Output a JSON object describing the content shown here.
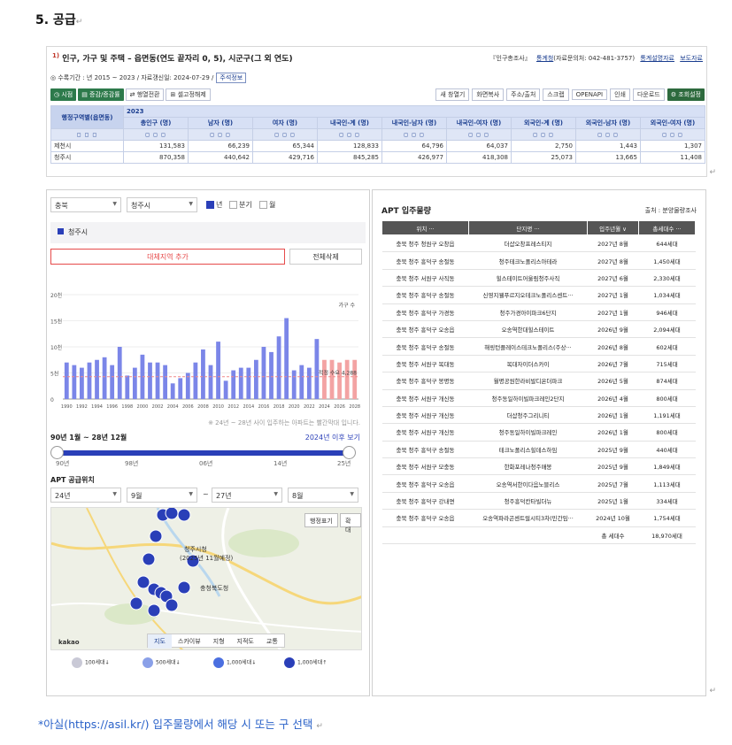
{
  "heading": "5.  공급",
  "kosis": {
    "title_sup": "1)",
    "title": "인구, 가구 및 주택 – 읍면동(연도 끝자리 0, 5), 시군구(그 외 연도)",
    "src_label": "『인구총조사』",
    "src_link": "통계청",
    "src_contact": "(자료문의처: 042-481-3757)",
    "link_desc": "통계설명자료",
    "link_press": "보도자료",
    "period_text": "◎ 수록기간 : 년 2015 ~ 2023 / 자료갱신일: 2024-07-29 /",
    "period_pill": "주석정보",
    "btn_period": "◷ 시점",
    "btn_item": "▤ 증감/증감률",
    "btn_toggle": "⇄ 행열전환",
    "btn_cell": "⊞ 셀고정해제",
    "tools": [
      "새 창열기",
      "화면복사",
      "주소/출처",
      "스크랩",
      "OPENAPI",
      "인쇄",
      "다운로드"
    ],
    "tool_setting": "⚙ 조회설정",
    "row_header": "행정구역별(읍면동)",
    "year": "2023",
    "columns": [
      "총인구 (명)",
      "남자 (명)",
      "여자 (명)",
      "내국인-계 (명)",
      "내국인-남자 (명)",
      "내국인-여자 (명)",
      "외국인-계 (명)",
      "외국인-남자 (명)",
      "외국인-여자 (명)"
    ],
    "ctl": "◻ ◻ ◻",
    "rows": [
      {
        "name": "제천시",
        "values": [
          "131,583",
          "66,239",
          "65,344",
          "128,833",
          "64,796",
          "64,037",
          "2,750",
          "1,443",
          "1,307"
        ]
      },
      {
        "name": "청주시",
        "values": [
          "870,358",
          "440,642",
          "429,716",
          "845,285",
          "426,977",
          "418,308",
          "25,073",
          "13,665",
          "11,408"
        ]
      }
    ]
  },
  "left": {
    "sel_region": "충북",
    "sel_city": "청주시",
    "chk_year": "년",
    "chk_quarter": "분기",
    "chk_month": "월",
    "legend": "청주시",
    "add_btn": "대체지역 추가",
    "del_btn": "전체삭제",
    "chart_note": "※ 24년 ~ 28년 사이 입주하는 아파트는 빨간막대 입니다.",
    "range_label": "90년 1월 ~ 28년 12월",
    "range_link": "2024년 이후 보기",
    "slider_ticks": [
      "90년",
      "98년",
      "06년",
      "14년",
      "25년"
    ],
    "supply_title": "APT 공급위치",
    "sel_from_year": "24년",
    "sel_from_month": "9월",
    "tilde": "~",
    "sel_to_year": "27년",
    "sel_to_month": "8월",
    "map_btn1": "행정표기",
    "map_btn2": "확대",
    "map_labels": [
      "청주시청",
      "(2025년 11월예정)",
      "충청북도청"
    ],
    "map_nav": [
      "지도",
      "스카이뷰",
      "지형",
      "지적도",
      "교통"
    ],
    "map_logo": "kakao",
    "pin_legend": [
      "100세대↓",
      "500세대↓",
      "1,000세대↓",
      "1,000세대↑"
    ]
  },
  "chart_data": {
    "type": "bar",
    "title": "",
    "series_label": "가구 수",
    "x": [
      1990,
      1991,
      1992,
      1993,
      1994,
      1995,
      1996,
      1997,
      1998,
      1999,
      2000,
      2001,
      2002,
      2003,
      2004,
      2005,
      2006,
      2007,
      2008,
      2009,
      2010,
      2011,
      2012,
      2013,
      2014,
      2015,
      2016,
      2017,
      2018,
      2019,
      2020,
      2021,
      2022,
      2023,
      2024,
      2025,
      2026,
      2027,
      2028
    ],
    "xticks": [
      "1990",
      "1992",
      "1994",
      "1996",
      "1998",
      "2000",
      "2002",
      "2004",
      "2006",
      "2008",
      "2010",
      "2012",
      "2014",
      "2016",
      "2018",
      "2020",
      "2022",
      "2024",
      "2026",
      "2028"
    ],
    "values": [
      7000,
      6500,
      6000,
      7000,
      7500,
      8000,
      6500,
      10000,
      4500,
      6000,
      8500,
      7000,
      7000,
      6500,
      3000,
      4000,
      5000,
      7000,
      9500,
      6500,
      11000,
      3500,
      5500,
      6000,
      6000,
      7500,
      10000,
      9000,
      12000,
      15500,
      5500,
      6500,
      6000,
      11500,
      7500,
      7500,
      7000,
      7500,
      7500
    ],
    "forecast_from": 2024,
    "demand_line": 4288,
    "demand_label": "적정 수요 4,288",
    "yticks": [
      0,
      5000,
      10000,
      15000,
      20000
    ],
    "ytick_labels": [
      "0",
      "5천",
      "10천",
      "15천",
      "20천"
    ],
    "ylim": [
      0,
      20000
    ],
    "colors": {
      "actual": "#7b86e8",
      "forecast": "#f3a3a3",
      "line": "#f08a8a"
    }
  },
  "right": {
    "title": "APT 입주물량",
    "source": "출처 : 분양물량조사",
    "headers": [
      "위치 ···",
      "단지명 ···",
      "입주년월 ∨",
      "총세대수 ···"
    ],
    "rows": [
      [
        "충북 청주 청원구 오창읍",
        "더샵오창프레스티지",
        "2027년 8월",
        "644세대"
      ],
      [
        "충북 청주 흥덕구 송절동",
        "청주테크노폴리스아테라",
        "2027년 8월",
        "1,450세대"
      ],
      [
        "충북 청주 서원구 사직동",
        "힐스테이트어울림청주사직",
        "2027년 6월",
        "2,330세대"
      ],
      [
        "충북 청주 흥덕구 송절동",
        "신영지웰푸르지오테크노폴리스센트···",
        "2027년 1월",
        "1,034세대"
      ],
      [
        "충북 청주 흥덕구 가경동",
        "청주가경아이파크6단지",
        "2027년 1월",
        "946세대"
      ],
      [
        "충북 청주 흥덕구 오송읍",
        "오송역한대힐스테이트",
        "2026년 9월",
        "2,094세대"
      ],
      [
        "충북 청주 흥덕구 송절동",
        "해링턴플레이스테크노폴리스(주상···",
        "2026년 8월",
        "602세대"
      ],
      [
        "충북 청주 서원구 복대동",
        "복대자이더스카이",
        "2026년 7월",
        "715세대"
      ],
      [
        "충북 청주 흥덕구 봉명동",
        "월명공원한라비발디온더파크",
        "2026년 5월",
        "874세대"
      ],
      [
        "충북 청주 서원구 개신동",
        "청주동일하이빌파크레인2단지",
        "2026년 4월",
        "800세대"
      ],
      [
        "충북 청주 서원구 개신동",
        "더샵청주그리니티",
        "2026년 1월",
        "1,191세대"
      ],
      [
        "충북 청주 서원구 개신동",
        "청주동일하이빌파크레인",
        "2026년 1월",
        "800세대"
      ],
      [
        "충북 청주 흥덕구 송절동",
        "테크노폴리스힐데스하임",
        "2025년 9월",
        "440세대"
      ],
      [
        "충북 청주 서원구 모충동",
        "한화포레나청주매봉",
        "2025년 9월",
        "1,849세대"
      ],
      [
        "충북 청주 흥덕구 오송읍",
        "오송역서한이다음노블리스",
        "2025년 7월",
        "1,113세대"
      ],
      [
        "충북 청주 흥덕구 강내면",
        "청주흥덕칸타빌더뉴",
        "2025년 1월",
        "334세대"
      ],
      [
        "충북 청주 흥덕구 오송읍",
        "오송역파라곤센트럴시티3차(민간임···",
        "2024년 10월",
        "1,754세대"
      ]
    ],
    "hl_prefix": "충북 청주 서",
    "hl_rest": "원구 모충동",
    "hl2_prefix": "충북 청주",
    "hl2_rest": " 흥덕구 오송읍",
    "total_label": "총 세대수",
    "total_value": "18,970세대"
  },
  "footer": "*아실(https://asil.kr/) 입주물량에서 해당 시 또는 구 선택",
  "mark": "↵"
}
